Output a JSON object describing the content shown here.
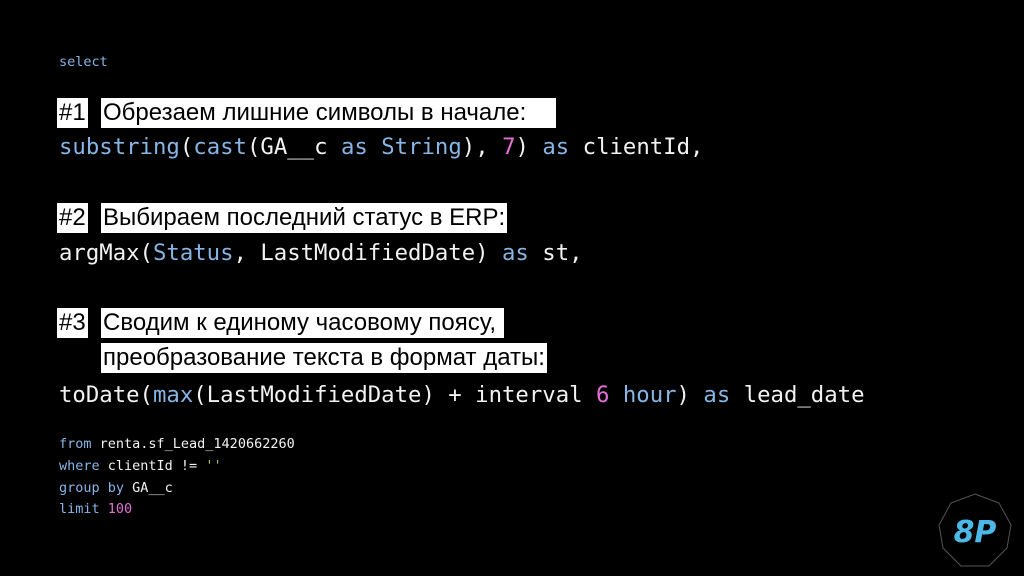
{
  "colors": {
    "background": "#000000",
    "keyword": "#86b5e6",
    "number": "#e36fd6",
    "string": "#9bd36a",
    "text": "#f2f2f2",
    "highlight": "#ffffff",
    "logo": "#4cb8e6"
  },
  "select_label": "select",
  "steps": [
    {
      "tag": "#1",
      "lines": [
        "Обрезаем лишние символы в начале:"
      ]
    },
    {
      "tag": "#2",
      "lines": [
        "Выбираем последний статус в ERP:"
      ]
    },
    {
      "tag": "#3",
      "lines": [
        "Сводим к единому часовому поясу,",
        "преобразование текста в формат даты:"
      ]
    }
  ],
  "code_lines": [
    [
      {
        "t": "substring",
        "c": "kw"
      },
      {
        "t": "(",
        "c": ""
      },
      {
        "t": "cast",
        "c": "kw"
      },
      {
        "t": "(GA__c ",
        "c": ""
      },
      {
        "t": "as",
        "c": "kw"
      },
      {
        "t": " ",
        "c": ""
      },
      {
        "t": "String",
        "c": "kw"
      },
      {
        "t": "), ",
        "c": ""
      },
      {
        "t": "7",
        "c": "num"
      },
      {
        "t": ") ",
        "c": ""
      },
      {
        "t": "as",
        "c": "kw"
      },
      {
        "t": " clientId,",
        "c": ""
      }
    ],
    [
      {
        "t": "argMax(",
        "c": ""
      },
      {
        "t": "Status",
        "c": "kw"
      },
      {
        "t": ", LastModifiedDate) ",
        "c": ""
      },
      {
        "t": "as",
        "c": "kw"
      },
      {
        "t": " st,",
        "c": ""
      }
    ],
    [
      {
        "t": "toDate(",
        "c": ""
      },
      {
        "t": "max",
        "c": "kw"
      },
      {
        "t": "(LastModifiedDate) + interval ",
        "c": ""
      },
      {
        "t": "6",
        "c": "num"
      },
      {
        "t": " ",
        "c": ""
      },
      {
        "t": "hour",
        "c": "kw"
      },
      {
        "t": ") ",
        "c": ""
      },
      {
        "t": "as",
        "c": "kw"
      },
      {
        "t": " lead_date",
        "c": ""
      }
    ]
  ],
  "footer_lines": [
    [
      {
        "t": "from",
        "c": "kw"
      },
      {
        "t": " renta.sf_Lead_1420662260",
        "c": ""
      }
    ],
    [
      {
        "t": "where",
        "c": "kw"
      },
      {
        "t": " clientId != ",
        "c": ""
      },
      {
        "t": "''",
        "c": "str"
      }
    ],
    [
      {
        "t": "group by",
        "c": "kw"
      },
      {
        "t": " GA__c",
        "c": ""
      }
    ],
    [
      {
        "t": "limit",
        "c": "kw"
      },
      {
        "t": " ",
        "c": ""
      },
      {
        "t": "100",
        "c": "num"
      }
    ]
  ],
  "logo": {
    "text": "8P",
    "icon": "octagon-logo"
  }
}
